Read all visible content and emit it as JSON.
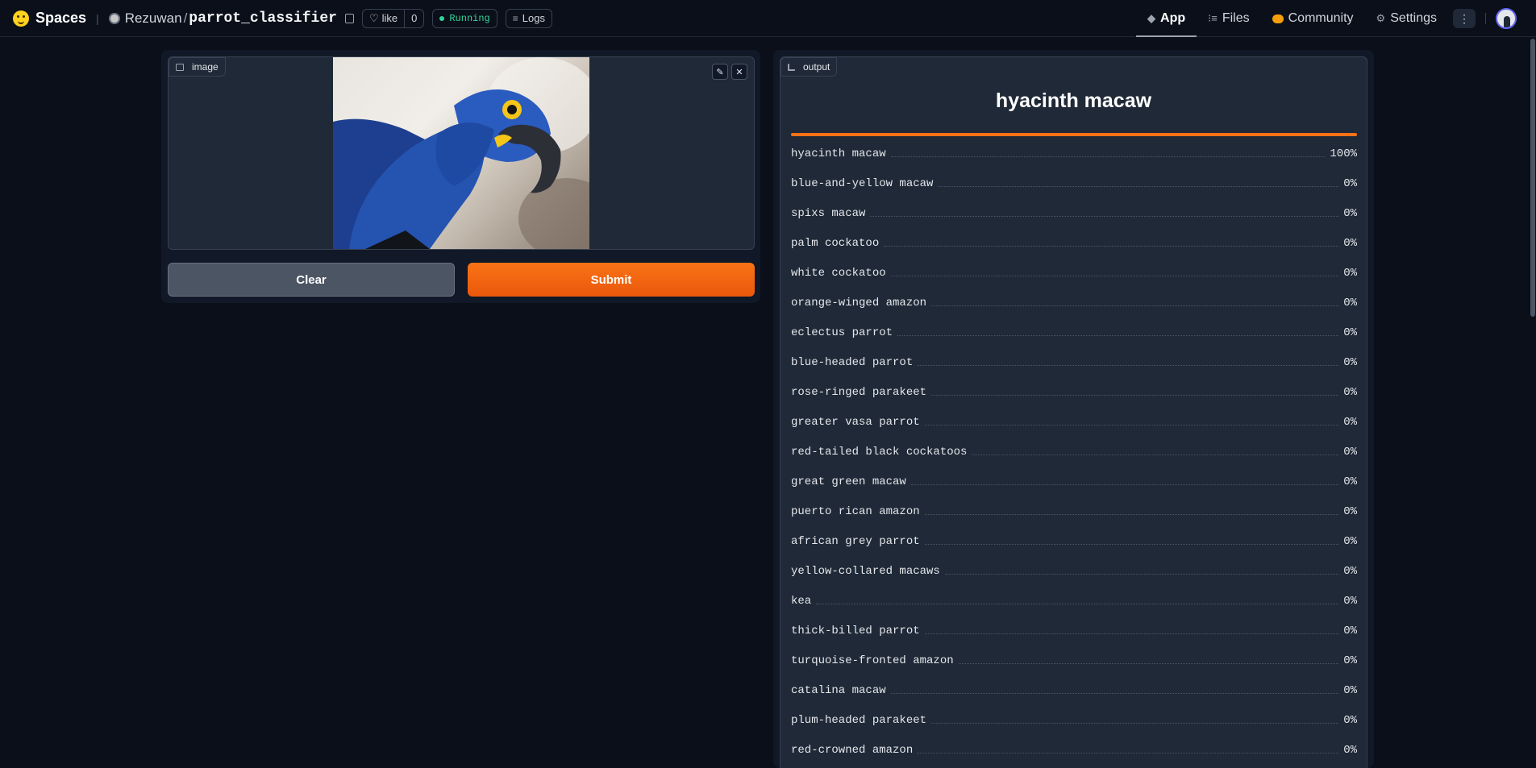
{
  "header": {
    "brand": "Spaces",
    "owner": "Rezuwan",
    "separator": "/",
    "repo": "parrot_classifier",
    "like_label": "like",
    "like_count": "0",
    "status": "Running",
    "logs_label": "Logs",
    "nav": [
      {
        "label": "App",
        "icon": "cube-icon"
      },
      {
        "label": "Files",
        "icon": "files-icon"
      },
      {
        "label": "Community",
        "icon": "community-icon"
      },
      {
        "label": "Settings",
        "icon": "gear-icon"
      }
    ],
    "more_label": "⋮"
  },
  "input": {
    "tag_label": "image",
    "clear_label": "Clear",
    "submit_label": "Submit"
  },
  "output": {
    "tag_label": "output",
    "top_label": "hyacinth macaw",
    "top_confidence": 1.0,
    "colors": {
      "accent": "#f97316",
      "background": "#0b0f19",
      "panel": "#1f2937"
    },
    "results": [
      {
        "label": "hyacinth macaw",
        "pct": "100%"
      },
      {
        "label": "blue-and-yellow macaw",
        "pct": "0%"
      },
      {
        "label": "spixs macaw",
        "pct": "0%"
      },
      {
        "label": "palm cockatoo",
        "pct": "0%"
      },
      {
        "label": "white cockatoo",
        "pct": "0%"
      },
      {
        "label": "orange-winged amazon",
        "pct": "0%"
      },
      {
        "label": "eclectus parrot",
        "pct": "0%"
      },
      {
        "label": "blue-headed parrot",
        "pct": "0%"
      },
      {
        "label": "rose-ringed parakeet",
        "pct": "0%"
      },
      {
        "label": "greater vasa parrot",
        "pct": "0%"
      },
      {
        "label": "red-tailed black cockatoos",
        "pct": "0%"
      },
      {
        "label": "great green macaw",
        "pct": "0%"
      },
      {
        "label": "puerto rican amazon",
        "pct": "0%"
      },
      {
        "label": "african grey parrot",
        "pct": "0%"
      },
      {
        "label": "yellow-collared macaws",
        "pct": "0%"
      },
      {
        "label": "kea",
        "pct": "0%"
      },
      {
        "label": "thick-billed parrot",
        "pct": "0%"
      },
      {
        "label": "turquoise-fronted amazon",
        "pct": "0%"
      },
      {
        "label": "catalina macaw",
        "pct": "0%"
      },
      {
        "label": "plum-headed parakeet",
        "pct": "0%"
      },
      {
        "label": "red-crowned amazon",
        "pct": "0%"
      }
    ]
  }
}
